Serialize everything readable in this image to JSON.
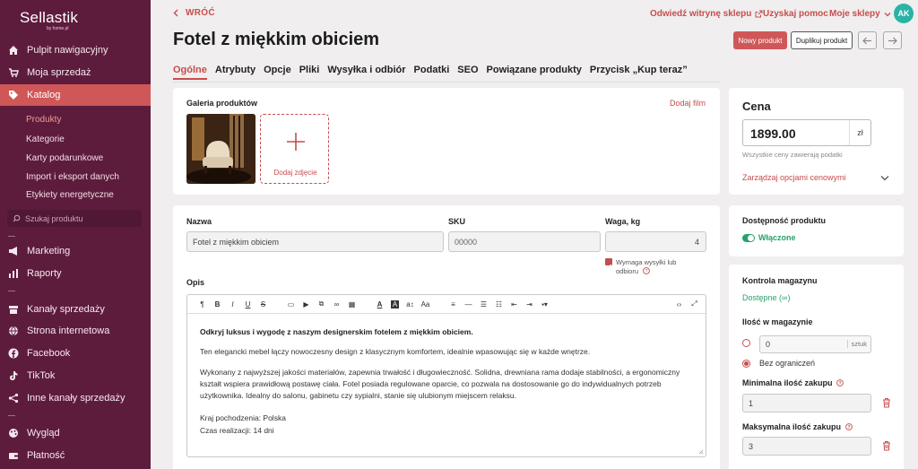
{
  "sidebar": {
    "logo": "Sellastik",
    "logo_sub": "by home.pl",
    "items": {
      "dashboard": "Pulpit nawigacyjny",
      "sales": "Moja sprzedaż",
      "catalog": "Katalog",
      "marketing": "Marketing",
      "reports": "Raporty",
      "channels": "Kanały sprzedaży",
      "website": "Strona internetowa",
      "facebook": "Facebook",
      "tiktok": "TikTok",
      "other_channels": "Inne kanały sprzedaży",
      "appearance": "Wygląd",
      "payment": "Płatność"
    },
    "catalog_sub": [
      "Produkty",
      "Kategorie",
      "Karty podarunkowe",
      "Import i eksport danych",
      "Etykiety energetyczne"
    ],
    "search_placeholder": "Szukaj produktu"
  },
  "topbar": {
    "back": "WRÓĆ",
    "visit_store": "Odwiedź witrynę sklepu",
    "help": "Uzyskaj pomoc",
    "my_stores": "Moje sklepy",
    "avatar": "AK"
  },
  "header": {
    "title": "Fotel z miękkim obiciem",
    "new_product": "Nowy produkt",
    "duplicate": "Duplikuj produkt"
  },
  "tabs": [
    "Ogólne",
    "Atrybuty",
    "Opcje",
    "Pliki",
    "Wysyłka i odbiór",
    "Podatki",
    "SEO",
    "Powiązane produkty",
    "Przycisk „Kup teraz”"
  ],
  "gallery": {
    "label": "Galeria produktów",
    "add_video": "Dodaj film",
    "add_photo": "Dodaj zdjęcie"
  },
  "form": {
    "name_label": "Nazwa",
    "name_value": "Fotel z miękkim obiciem",
    "sku_label": "SKU",
    "sku_value": "00000",
    "weight_label": "Waga, kg",
    "weight_value": "4",
    "shipping_required": "Wymaga wysyłki lub",
    "shipping_required_2": "odbioru",
    "desc_label": "Opis"
  },
  "description": {
    "headline": "Odkryj luksus i wygodę z naszym designerskim fotelem z miękkim obiciem.",
    "p1": "Ten elegancki mebel łączy nowoczesny design z klasycznym komfortem, idealnie wpasowując się w każde wnętrze.",
    "p2_1": "Wykonany z najwyższej jakości materiałów, zapewnia trwałość i długowieczność. Solidna, drewniana rama dodaje stabilności, a ergonomiczny",
    "p2_2": "kształt wspiera prawidłową postawę ciała. Fotel posiada regulowane oparcie, co pozwala na dostosowanie go do indywidualnych potrzeb",
    "p2_3": "użytkownika. Idealny do salonu, gabinetu czy sypialni, stanie się ulubionym miejscem relaksu.",
    "origin": "Kraj pochodzenia: Polska",
    "lead_time": "Czas realizacji: 14 dni"
  },
  "price": {
    "label": "Cena",
    "value": "1899.00",
    "currency": "zł",
    "note": "Wszystkie ceny zawierają podatki",
    "manage": "Zarządzaj opcjami cenowymi"
  },
  "availability": {
    "label": "Dostępność produktu",
    "status": "Włączone"
  },
  "stock": {
    "label": "Kontrola magazynu",
    "status": "Dostępne (∞)",
    "qty_label": "Ilość w magazynie",
    "qty_value": "0",
    "qty_unit": "sztuk",
    "unlimited": "Bez ograniczeń",
    "min_label": "Minimalna ilość zakupu",
    "min_value": "1",
    "max_label": "Maksymalna ilość zakupu",
    "max_value": "3"
  },
  "colors": {
    "accent": "#c64d4d",
    "sidebar": "#5e1c3c",
    "success": "#26a269"
  }
}
